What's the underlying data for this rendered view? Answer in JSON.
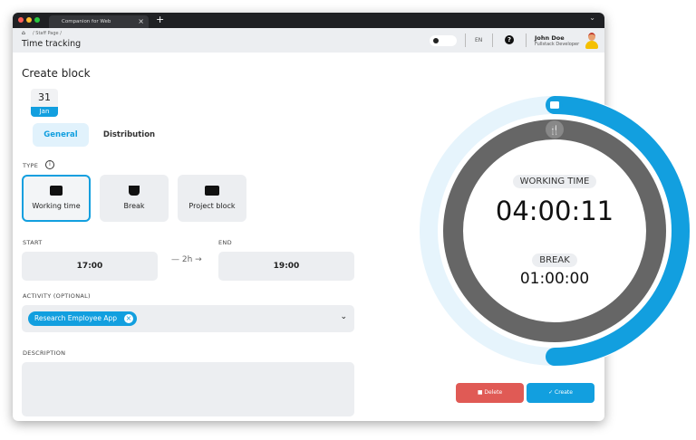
{
  "browser": {
    "tab_title": "Companion for Web",
    "new_tab": "+",
    "close": "×",
    "menu": "⌄"
  },
  "header": {
    "breadcrumb": "/ Staff Page /",
    "title": "Time tracking",
    "language": "EN",
    "help": "?",
    "user_name": "John Doe",
    "user_role": "Fullstack Developer"
  },
  "form": {
    "title": "Create block",
    "date": {
      "day": "31",
      "month": "Jan"
    },
    "tabs": [
      {
        "label": "General",
        "active": true
      },
      {
        "label": "Distribution",
        "active": false
      }
    ],
    "type_label": "TYPE",
    "types": [
      {
        "label": "Working time",
        "icon": "briefcase-icon",
        "selected": true
      },
      {
        "label": "Break",
        "icon": "coffee-icon",
        "selected": false
      },
      {
        "label": "Project block",
        "icon": "card-icon",
        "selected": false
      }
    ],
    "start_label": "START",
    "start_value": "17:00",
    "duration": "2h",
    "end_label": "END",
    "end_value": "19:00",
    "activity_label": "ACTIVITY (OPTIONAL)",
    "activity_chip": "Research Employee App",
    "description_label": "DESCRIPTION",
    "description_value": ""
  },
  "actions": {
    "delete": "Delete",
    "create": "Create"
  },
  "timer": {
    "working_label": "WORKING TIME",
    "working_value": "04:00:11",
    "break_label": "BREAK",
    "break_value": "01:00:00",
    "working_progress": 0.5,
    "colors": {
      "accent": "#129fdf",
      "track": "#e6f4fc",
      "break_ring": "#666666",
      "delete": "#e05a55"
    }
  }
}
